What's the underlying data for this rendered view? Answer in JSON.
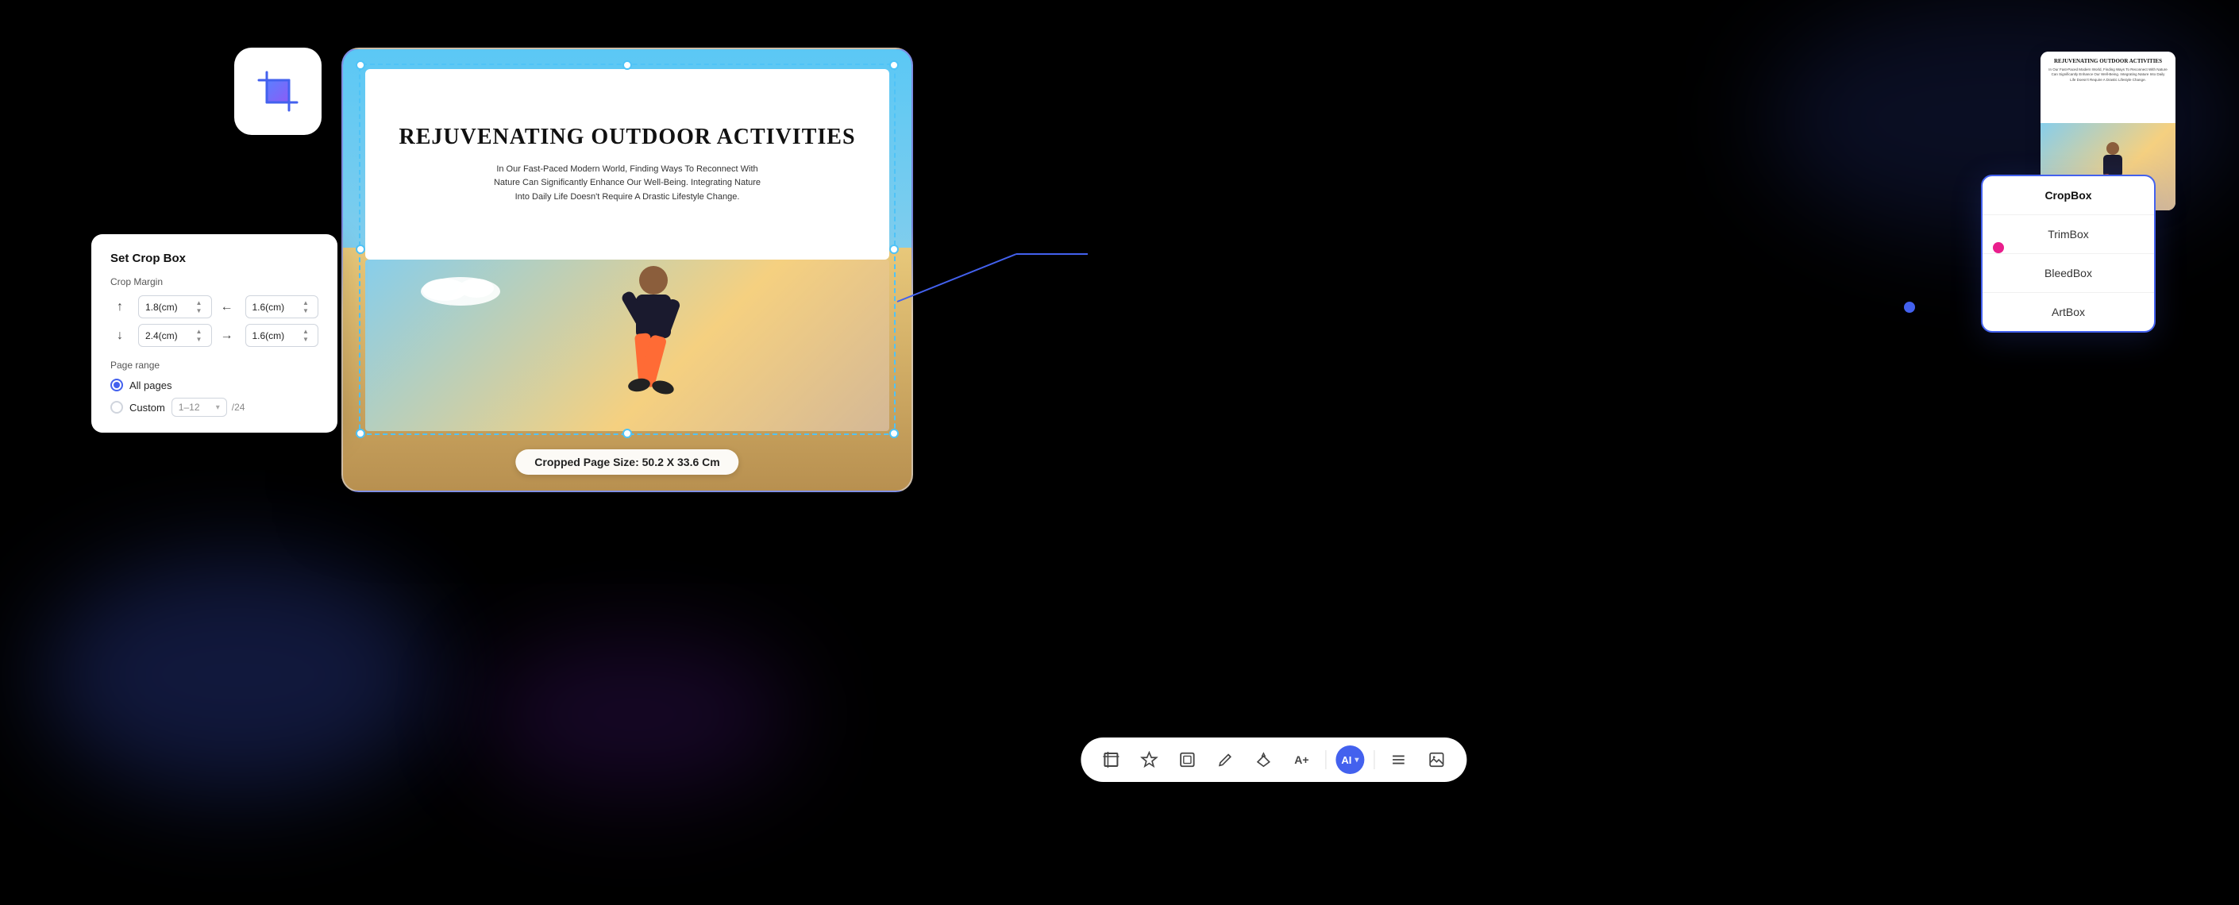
{
  "scene": {
    "background": "#000000"
  },
  "crop_icon_card": {
    "aria": "Crop tool icon"
  },
  "pdf_preview": {
    "title": "REJUVENATING OUTDOOR ACTIVITIES",
    "subtitle": "In Our Fast-Paced Modern World, Finding Ways To Reconnect With Nature Can Significantly Enhance Our Well-Being. Integrating Nature Into Daily Life Doesn't Require A Drastic Lifestyle Change.",
    "cropped_size": "Cropped Page Size: 50.2 X 33.6 Cm"
  },
  "thumbnail": {
    "title": "REJUVENATING OUTDOOR ACTIVITIES",
    "subtitle": "In Our Fast-Paced Modern World, Finding Ways To Reconnect With Nature Can Significantly Enhance Our Well-Being. Integrating Nature Into Daily Life Doesn't Require A Drastic Lifestyle Change."
  },
  "set_crop_box_panel": {
    "title": "Set Crop Box",
    "crop_margin_label": "Crop Margin",
    "margins": {
      "top": "1.8(cm)",
      "bottom": "2.4(cm)",
      "left": "1.6(cm)",
      "right": "1.6(cm)"
    },
    "page_range_label": "Page range",
    "all_pages_label": "All pages",
    "custom_label": "Custom",
    "custom_range": "1–12",
    "total_pages": "/24"
  },
  "cropbox_type_panel": {
    "items": [
      {
        "label": "CropBox",
        "active": true
      },
      {
        "label": "TrimBox",
        "active": false
      },
      {
        "label": "BleedBox",
        "active": false
      },
      {
        "label": "ArtBox",
        "active": false
      }
    ]
  },
  "toolbar": {
    "icons": [
      {
        "name": "crop-tool-icon",
        "symbol": "⛶",
        "label": "Crop"
      },
      {
        "name": "star-icon",
        "symbol": "✦",
        "label": "Star"
      },
      {
        "name": "frame-icon",
        "symbol": "▣",
        "label": "Frame"
      },
      {
        "name": "edit-icon",
        "symbol": "✎",
        "label": "Edit"
      },
      {
        "name": "brush-icon",
        "symbol": "⬡",
        "label": "Brush"
      },
      {
        "name": "text-plus-icon",
        "symbol": "A+",
        "label": "Text+"
      },
      {
        "name": "ai-icon",
        "label": "AI"
      },
      {
        "name": "list-icon",
        "symbol": "≡",
        "label": "List"
      },
      {
        "name": "image-icon",
        "symbol": "⊞",
        "label": "Image"
      }
    ]
  }
}
